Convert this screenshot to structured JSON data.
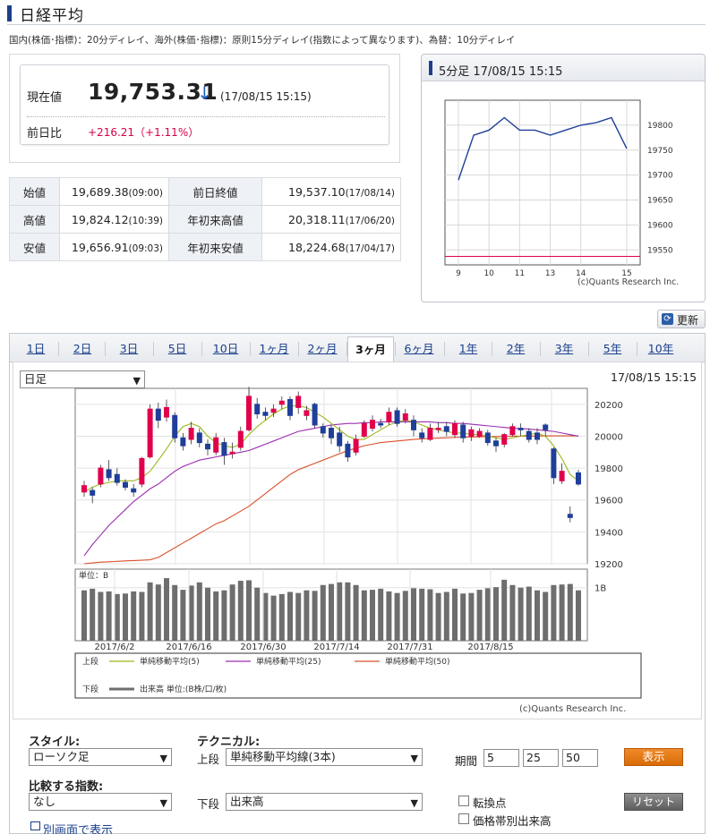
{
  "header": {
    "title": "日経平均",
    "note": "国内(株価･指標)：20分ディレイ、海外(株価･指標)：原則15分ディレイ(指数によって異なります)、為替：10分ディレイ"
  },
  "price": {
    "label": "現在値",
    "value": "19,753.31",
    "arrow": "↓",
    "time": "(17/08/15 15:15)",
    "change_label": "前日比",
    "change": "+216.21（+1.11%）"
  },
  "stats": [
    {
      "l1": "始値",
      "v1": "19,689.38",
      "t1": "(09:00)",
      "l2": "前日終値",
      "v2": "19,537.10",
      "t2": "(17/08/14)"
    },
    {
      "l1": "高値",
      "v1": "19,824.12",
      "t1": "(10:39)",
      "l2": "年初来高値",
      "v2": "20,318.11",
      "t2": "(17/06/20)"
    },
    {
      "l1": "安値",
      "v1": "19,656.91",
      "t1": "(09:03)",
      "l2": "年初来安値",
      "v2": "18,224.68",
      "t2": "(17/04/17)"
    }
  ],
  "mini": {
    "title": "5分足 17/08/15 15:15",
    "copyright": "(c)Quants Research Inc."
  },
  "refresh_label": "更新",
  "tabs": [
    "1日",
    "2日",
    "3日",
    "5日",
    "10日",
    "1ヶ月",
    "2ヶ月",
    "3ヶ月",
    "6ヶ月",
    "1年",
    "2年",
    "3年",
    "5年",
    "10年"
  ],
  "active_tab": "3ヶ月",
  "chart_select": "日足",
  "chart_datetime": "17/08/15 15:15",
  "volume_unit": "単位：B",
  "volume_tick": "1B",
  "main_copyright": "(c)Quants Research Inc.",
  "legend": {
    "upper": "上段",
    "lower": "下段",
    "ma5": "単純移動平均(5)",
    "ma25": "単純移動平均(25)",
    "ma50": "単純移動平均(50)",
    "vol": "出来高 単位:(B株/口/枚)"
  },
  "controls": {
    "style_label": "スタイル:",
    "style_value": "ローソク足",
    "tech_label": "テクニカル:",
    "upper_label": "上段",
    "upper_value": "単純移動平均線(3本)",
    "period_label": "期間",
    "periods": [
      "5",
      "25",
      "50"
    ],
    "show_btn": "表示",
    "compare_label": "比較する指数:",
    "compare_value": "なし",
    "lower_label": "下段",
    "lower_value": "出来高",
    "chk1": "転換点",
    "chk2": "価格帯別出来高",
    "reset_btn": "リセット",
    "newwin": "別画面で表示"
  },
  "colors": {
    "up": "#e0004c",
    "down": "#1f3f9a",
    "ma5": "#9ab81c",
    "ma25": "#9a2fb0",
    "ma50": "#d8502a",
    "volume": "#6e6e6e"
  },
  "chart_data": [
    {
      "type": "line",
      "x": [
        "9:00",
        "9:30",
        "10:00",
        "10:30",
        "11:00",
        "11:30",
        "12:30",
        "13:00",
        "13:30",
        "14:00",
        "14:30",
        "15:00"
      ],
      "values": [
        19690,
        19780,
        19790,
        19815,
        19790,
        19790,
        19780,
        19790,
        19800,
        19805,
        19815,
        19753
      ],
      "ylim": [
        19520,
        19850
      ],
      "yticks": [
        19550,
        19600,
        19650,
        19700,
        19750,
        19800
      ],
      "xticks": [
        "9",
        "10",
        "11",
        "13",
        "14",
        "15"
      ]
    },
    {
      "type": "candlestick",
      "xticks": [
        "2017/6/2",
        "2017/6/16",
        "2017/6/30",
        "2017/7/14",
        "2017/7/31",
        "2017/8/15"
      ],
      "yticks": [
        19200,
        19400,
        19600,
        19800,
        20000,
        20200
      ],
      "ylim": [
        19200,
        20300
      ],
      "candles": [
        [
          19650,
          19690,
          19620,
          19720
        ],
        [
          19660,
          19630,
          19580,
          19680
        ],
        [
          19700,
          19800,
          19680,
          19820
        ],
        [
          19790,
          19740,
          19720,
          19850
        ],
        [
          19760,
          19710,
          19690,
          19800
        ],
        [
          19710,
          19680,
          19660,
          19730
        ],
        [
          19670,
          19650,
          19620,
          19700
        ],
        [
          19700,
          19860,
          19680,
          19870
        ],
        [
          19870,
          20170,
          19860,
          20200
        ],
        [
          20170,
          20100,
          20050,
          20210
        ],
        [
          20120,
          20180,
          20090,
          20230
        ],
        [
          20130,
          19990,
          19960,
          20150
        ],
        [
          19990,
          19940,
          19910,
          20020
        ],
        [
          19980,
          20050,
          19950,
          20090
        ],
        [
          20020,
          19960,
          19930,
          20050
        ],
        [
          19950,
          19920,
          19880,
          19980
        ],
        [
          19900,
          19990,
          19880,
          20020
        ],
        [
          19960,
          19880,
          19820,
          19990
        ],
        [
          19890,
          19900,
          19860,
          19960
        ],
        [
          19930,
          20030,
          19910,
          20060
        ],
        [
          20040,
          20250,
          20030,
          20310
        ],
        [
          20200,
          20140,
          20110,
          20240
        ],
        [
          20150,
          20130,
          20100,
          20180
        ],
        [
          20150,
          20170,
          20120,
          20200
        ],
        [
          20200,
          20220,
          20170,
          20250
        ],
        [
          20230,
          20130,
          20100,
          20250
        ],
        [
          20180,
          20250,
          20140,
          20280
        ],
        [
          20130,
          20160,
          20100,
          20190
        ],
        [
          20200,
          20070,
          20050,
          20210
        ],
        [
          20060,
          20020,
          19990,
          20080
        ],
        [
          20050,
          19990,
          19950,
          20070
        ],
        [
          20020,
          19940,
          19900,
          20060
        ],
        [
          19950,
          19870,
          19840,
          19970
        ],
        [
          19900,
          19980,
          19880,
          20010
        ],
        [
          20000,
          20080,
          19990,
          20100
        ],
        [
          20050,
          20100,
          20030,
          20130
        ],
        [
          20080,
          20070,
          20050,
          20110
        ],
        [
          20090,
          20150,
          20070,
          20180
        ],
        [
          20160,
          20080,
          20060,
          20180
        ],
        [
          20100,
          20140,
          20080,
          20170
        ],
        [
          20100,
          20040,
          20000,
          20130
        ],
        [
          20020,
          19990,
          19960,
          20050
        ],
        [
          19980,
          20050,
          19970,
          20080
        ],
        [
          20050,
          20050,
          20020,
          20090
        ],
        [
          20060,
          20030,
          20000,
          20090
        ],
        [
          20010,
          20080,
          19990,
          20100
        ],
        [
          20070,
          19990,
          19960,
          20090
        ],
        [
          20000,
          20040,
          19970,
          20060
        ],
        [
          20000,
          20030,
          19990,
          20050
        ],
        [
          20020,
          19960,
          19940,
          20040
        ],
        [
          19970,
          19940,
          19900,
          19990
        ],
        [
          19950,
          20010,
          19930,
          20020
        ],
        [
          20010,
          20060,
          20000,
          20080
        ],
        [
          20050,
          20040,
          20000,
          20080
        ],
        [
          20030,
          19980,
          19960,
          20050
        ],
        [
          20020,
          19980,
          19950,
          20050
        ],
        [
          20070,
          20040,
          20000,
          20080
        ],
        [
          19920,
          19740,
          19700,
          19930
        ],
        [
          19720,
          19780,
          19700,
          19830
        ],
        [
          19510,
          19490,
          19460,
          19560
        ],
        [
          19770,
          19700,
          19690,
          19790
        ]
      ],
      "ma5": [
        19650,
        19680,
        19700,
        19710,
        19720,
        19720,
        19720,
        19740,
        19780,
        19850,
        19920,
        20000,
        20060,
        20080,
        20060,
        20000,
        19960,
        19940,
        19930,
        19950,
        20010,
        20060,
        20100,
        20140,
        20170,
        20190,
        20190,
        20180,
        20150,
        20120,
        20080,
        20040,
        20000,
        19980,
        19980,
        20010,
        20040,
        20070,
        20090,
        20100,
        20090,
        20070,
        20050,
        20040,
        20030,
        20020,
        20020,
        20010,
        20010,
        20000,
        19990,
        19980,
        19990,
        20000,
        20010,
        20020,
        20000,
        19940,
        19860,
        19760,
        19720
      ],
      "ma25": [
        19250,
        19320,
        19380,
        19440,
        19490,
        19540,
        19590,
        19630,
        19670,
        19700,
        19740,
        19780,
        19810,
        19830,
        19850,
        19860,
        19870,
        19880,
        19890,
        19900,
        19910,
        19930,
        19950,
        19970,
        19990,
        20010,
        20030,
        20040,
        20050,
        20060,
        20070,
        20075,
        20080,
        20080,
        20085,
        20085,
        20090,
        20090,
        20090,
        20090,
        20090,
        20090,
        20090,
        20085,
        20085,
        20080,
        20080,
        20075,
        20070,
        20065,
        20060,
        20055,
        20050,
        20048,
        20045,
        20040,
        20035,
        20030,
        20020,
        20010,
        20000
      ],
      "ma50": [
        19200,
        19205,
        19210,
        19212,
        19215,
        19218,
        19220,
        19222,
        19225,
        19240,
        19270,
        19300,
        19330,
        19360,
        19390,
        19420,
        19450,
        19470,
        19500,
        19530,
        19560,
        19600,
        19640,
        19680,
        19720,
        19760,
        19790,
        19810,
        19830,
        19850,
        19870,
        19890,
        19910,
        19925,
        19940,
        19950,
        19960,
        19965,
        19970,
        19975,
        19980,
        19983,
        19986,
        19988,
        19990,
        19992,
        19994,
        19995,
        19996,
        19997,
        19998,
        19999,
        20000,
        20000,
        20001,
        20001,
        20002,
        20002,
        20002,
        20002,
        20002
      ],
      "volume": [
        0.95,
        0.98,
        0.92,
        0.93,
        0.88,
        0.89,
        0.93,
        0.92,
        1.1,
        1.06,
        1.18,
        1.05,
        0.96,
        1.04,
        1.1,
        1.0,
        0.93,
        0.95,
        1.06,
        1.13,
        1.14,
        1.0,
        0.9,
        0.85,
        0.88,
        0.92,
        0.9,
        0.95,
        0.94,
        1.05,
        1.07,
        1.1,
        1.1,
        1.05,
        0.95,
        0.96,
        0.98,
        0.93,
        0.9,
        0.94,
        0.99,
        0.98,
        0.97,
        0.9,
        0.92,
        0.98,
        0.89,
        0.9,
        0.96,
        0.99,
        1.01,
        1.15,
        1.05,
        1.0,
        1.02,
        0.95,
        0.92,
        1.05,
        1.06,
        1.07,
        0.95
      ]
    }
  ]
}
